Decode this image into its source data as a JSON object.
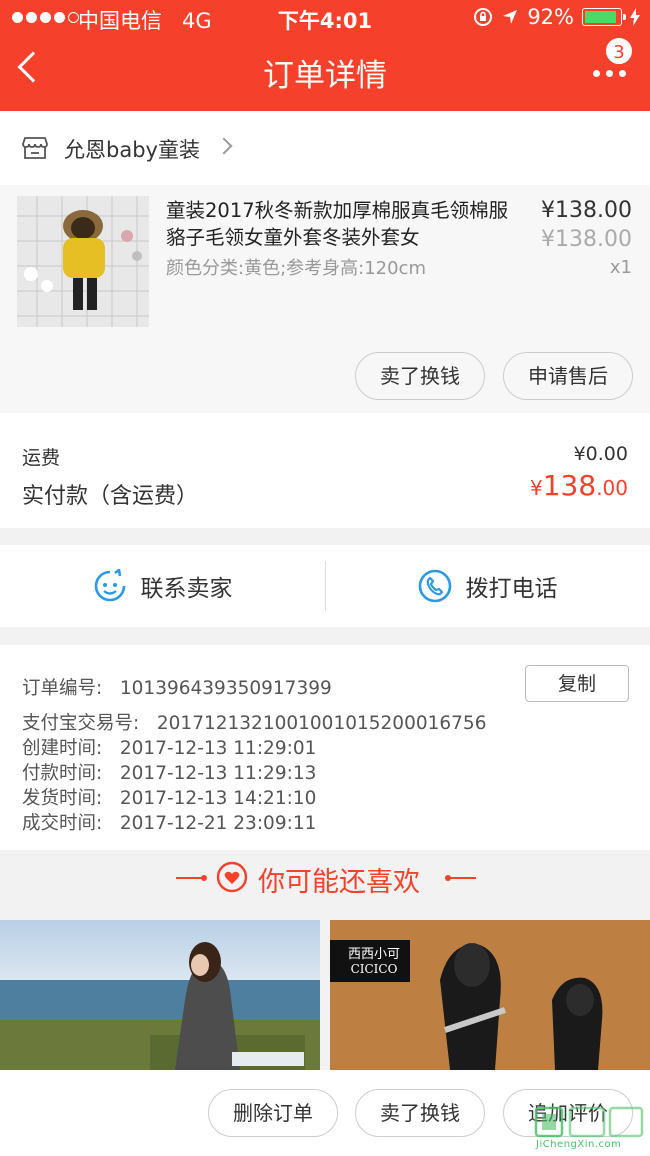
{
  "status_bar": {
    "carrier": "中国电信",
    "network": "4G",
    "time": "下午4:01",
    "battery_percent": "92%",
    "battery_level": 0.92
  },
  "nav": {
    "title": "订单详情",
    "more_badge": "3"
  },
  "shop": {
    "name": "允恩baby童装"
  },
  "product": {
    "title": "童装2017秋冬新款加厚棉服真毛领棉服貉子毛领女童外套冬装外套女",
    "sku": "颜色分类:黄色;参考身高:120cm",
    "price": "¥138.00",
    "original_price": "¥138.00",
    "quantity": "x1",
    "buttons": {
      "resell": "卖了换钱",
      "after_sale": "申请售后"
    }
  },
  "fees": {
    "shipping_label": "运费",
    "shipping_value": "¥0.00",
    "paid_label": "实付款（含运费）",
    "paid_currency": "¥",
    "paid_integer": "138",
    "paid_decimal": ".00"
  },
  "contact": {
    "seller": "联系卖家",
    "phone": "拨打电话"
  },
  "order_info": {
    "order_no_label": "订单编号:",
    "order_no": "101396439350917399",
    "copy": "复制",
    "alipay_label": "支付宝交易号:",
    "alipay_no": "2017121321001001015200016756",
    "created_label": "创建时间:",
    "created": "2017-12-13 11:29:01",
    "paid_label": "付款时间:",
    "paid": "2017-12-13 11:29:13",
    "shipped_label": "发货时间:",
    "shipped": "2017-12-13 14:21:10",
    "closed_label": "成交时间:",
    "closed": "2017-12-21 23:09:11"
  },
  "recommend": {
    "title": "你可能还喜欢",
    "item2_brand_cn": "西西小可",
    "item2_brand_en": "CICICO"
  },
  "bottom_actions": {
    "delete": "删除订单",
    "resell": "卖了换钱",
    "review": "追加评价"
  },
  "watermark": {
    "text": "JiChengXin.com"
  },
  "colors": {
    "accent": "#f5412b",
    "contact_icon": "#2a9ae6"
  }
}
